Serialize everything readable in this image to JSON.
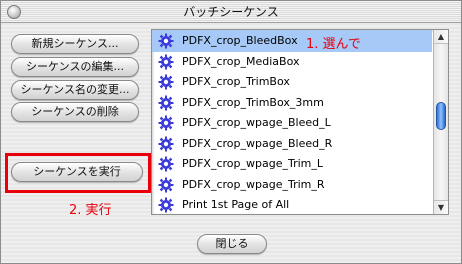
{
  "window": {
    "title": "バッチシーケンス"
  },
  "buttons": {
    "new_sequence": "新規シーケンス...",
    "edit_sequence": "シーケンスの編集...",
    "rename_sequence": "シーケンス名の変更...",
    "delete_sequence": "シーケンスの削除",
    "run_sequence": "シーケンスを実行",
    "close": "閉じる"
  },
  "annotations": {
    "step1": "1. 選んで",
    "step2": "2. 実行"
  },
  "sequences": [
    {
      "name": "PDFX_crop_BleedBox",
      "selected": true,
      "icon": "gear-icon"
    },
    {
      "name": "PDFX_crop_MediaBox",
      "selected": false,
      "icon": "gear-icon"
    },
    {
      "name": "PDFX_crop_TrimBox",
      "selected": false,
      "icon": "gear-icon"
    },
    {
      "name": "PDFX_crop_TrimBox_3mm",
      "selected": false,
      "icon": "gear-icon"
    },
    {
      "name": "PDFX_crop_wpage_Bleed_L",
      "selected": false,
      "icon": "gear-icon"
    },
    {
      "name": "PDFX_crop_wpage_Bleed_R",
      "selected": false,
      "icon": "gear-icon"
    },
    {
      "name": "PDFX_crop_wpage_Trim_L",
      "selected": false,
      "icon": "gear-icon"
    },
    {
      "name": "PDFX_crop_wpage_Trim_R",
      "selected": false,
      "icon": "gear-icon"
    },
    {
      "name": "Print 1st Page of All",
      "selected": false,
      "icon": "gear-icon"
    }
  ],
  "colors": {
    "selection": "#a6c9f7",
    "annotation": "#e8000b",
    "scroll_thumb": "#3a7de0",
    "gear_icon": "#3b3bd9"
  }
}
